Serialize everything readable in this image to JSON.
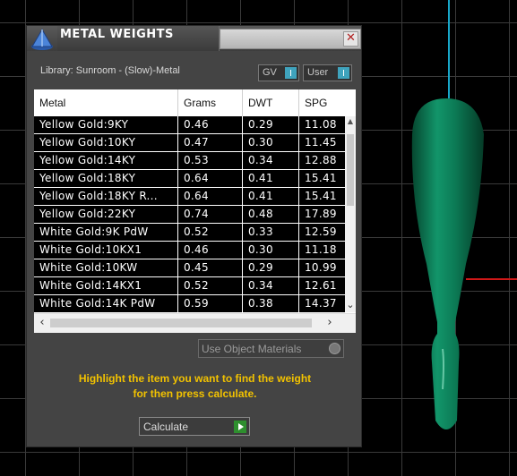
{
  "window": {
    "title": "METAL WEIGHTS",
    "close_glyph": "✕"
  },
  "library": {
    "label": "Library: Sunroom - (Slow)-Metal"
  },
  "toggles": {
    "gv": "GV",
    "user": "User"
  },
  "table": {
    "columns": [
      "Metal",
      "Grams",
      "DWT",
      "SPG"
    ],
    "rows": [
      [
        "Yellow Gold:9KY",
        "0.46",
        "0.29",
        "11.08"
      ],
      [
        "Yellow Gold:10KY",
        "0.47",
        "0.30",
        "11.45"
      ],
      [
        "Yellow Gold:14KY",
        "0.53",
        "0.34",
        "12.88"
      ],
      [
        "Yellow Gold:18KY",
        "0.64",
        "0.41",
        "15.41"
      ],
      [
        "Yellow Gold:18KY R...",
        "0.64",
        "0.41",
        "15.41"
      ],
      [
        "Yellow Gold:22KY",
        "0.74",
        "0.48",
        "17.89"
      ],
      [
        "White Gold:9K PdW",
        "0.52",
        "0.33",
        "12.59"
      ],
      [
        "White Gold:10KX1",
        "0.46",
        "0.30",
        "11.18"
      ],
      [
        "White Gold:10KW",
        "0.45",
        "0.29",
        "10.99"
      ],
      [
        "White Gold:14KX1",
        "0.52",
        "0.34",
        "12.61"
      ],
      [
        "White Gold:14K PdW",
        "0.59",
        "0.38",
        "14.37"
      ]
    ]
  },
  "options": {
    "use_object_materials": "Use Object Materials"
  },
  "hint": {
    "line1": "Highlight the item you want to find the weight",
    "line2": "for then press calculate."
  },
  "actions": {
    "calculate": "Calculate"
  },
  "colors": {
    "hint": "#f2c200",
    "object": "#0f8a5e",
    "axis_y": "#18a7c9",
    "axis_x": "#d01818"
  }
}
